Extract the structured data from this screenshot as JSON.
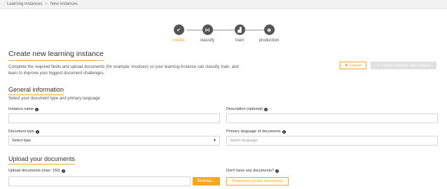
{
  "breadcrumb": {
    "parent": "Learning instances",
    "separator": ">",
    "current": "New instances"
  },
  "steps": [
    {
      "label": "create",
      "icon": "check-icon",
      "active": true
    },
    {
      "label": "classify",
      "icon": "classify-icon",
      "active": false
    },
    {
      "label": "train",
      "icon": "train-icon",
      "active": false
    },
    {
      "label": "production",
      "icon": "production-icon",
      "active": false
    }
  ],
  "page": {
    "title": "Create new learning instance",
    "description": "Complete the required fields and upload documents (for example: Invoices) so your learning instance can classify, train, and learn to improve your biggest document challenges."
  },
  "actions": {
    "cancel": "Cancel",
    "create": "Create instance and analyze"
  },
  "general": {
    "title": "General information",
    "subtitle": "Select your document type and primary language",
    "instance_name_label": "Instance name",
    "description_label": "Description (optional)",
    "document_type_label": "Document type",
    "document_type_value": "Select type",
    "language_label": "Primary language of documents",
    "language_placeholder": "Select language"
  },
  "upload": {
    "title": "Upload your documents",
    "upload_label": "Upload documents (max: 150)",
    "browse": "Browse...",
    "sample_question": "Don't have any documents?",
    "download": "Download sample documents"
  },
  "colors": {
    "accent": "#f5a623",
    "step": "#555555"
  }
}
